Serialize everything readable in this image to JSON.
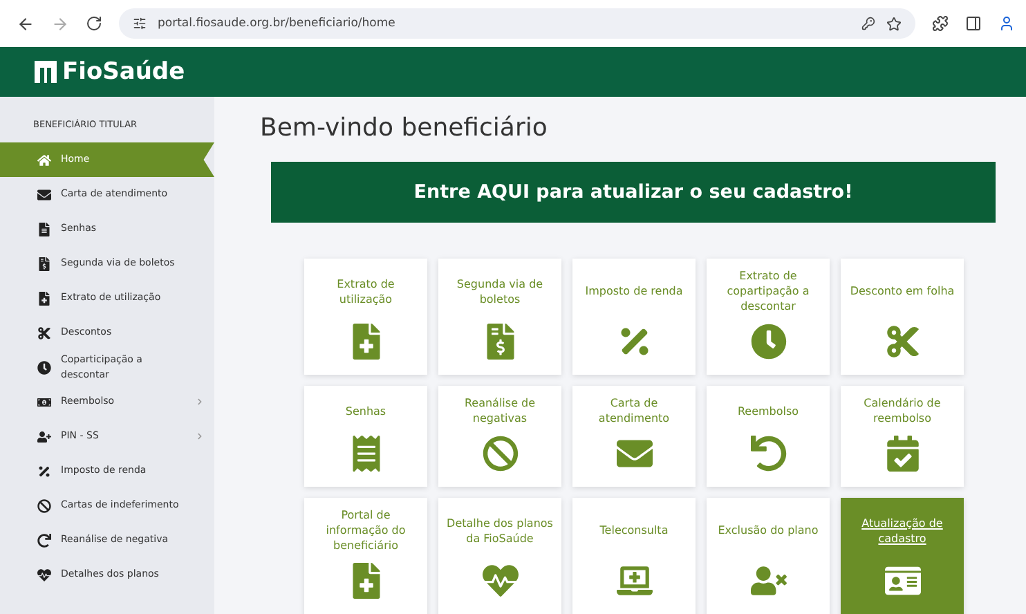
{
  "browser": {
    "url": "portal.fiosaude.org.br/beneficiario/home"
  },
  "header": {
    "logo": "FioSaúde"
  },
  "sidebar": {
    "heading": "BENEFICIÁRIO TITULAR",
    "items": [
      {
        "label": "Home",
        "selected": true,
        "submenu": false
      },
      {
        "label": "Carta de atendimento",
        "selected": false,
        "submenu": false
      },
      {
        "label": "Senhas",
        "selected": false,
        "submenu": false
      },
      {
        "label": "Segunda via de boletos",
        "selected": false,
        "submenu": false
      },
      {
        "label": "Extrato de utilização",
        "selected": false,
        "submenu": false
      },
      {
        "label": "Descontos",
        "selected": false,
        "submenu": false
      },
      {
        "label": "Coparticipação a descontar",
        "selected": false,
        "submenu": false
      },
      {
        "label": "Reembolso",
        "selected": false,
        "submenu": true
      },
      {
        "label": "PIN - SS",
        "selected": false,
        "submenu": true
      },
      {
        "label": "Imposto de renda",
        "selected": false,
        "submenu": false
      },
      {
        "label": "Cartas de indeferimento",
        "selected": false,
        "submenu": false
      },
      {
        "label": "Reanálise de negativa",
        "selected": false,
        "submenu": false
      },
      {
        "label": "Detalhes dos planos",
        "selected": false,
        "submenu": false
      }
    ]
  },
  "main": {
    "title": "Bem-vindo beneficiário",
    "banner": "Entre AQUI para atualizar o seu cadastro!",
    "tiles": [
      {
        "label": "Extrato de utilização",
        "highlighted": false
      },
      {
        "label": "Segunda via de boletos",
        "highlighted": false
      },
      {
        "label": "Imposto de renda",
        "highlighted": false
      },
      {
        "label": "Extrato de copartipação a descontar",
        "highlighted": false
      },
      {
        "label": "Desconto em folha",
        "highlighted": false
      },
      {
        "label": "Senhas",
        "highlighted": false
      },
      {
        "label": "Reanálise de negativas",
        "highlighted": false
      },
      {
        "label": "Carta de atendimento",
        "highlighted": false
      },
      {
        "label": "Reembolso",
        "highlighted": false
      },
      {
        "label": "Calendário de reembolso",
        "highlighted": false
      },
      {
        "label": "Portal de informação do beneficiário",
        "highlighted": false
      },
      {
        "label": "Detalhe dos planos da FioSaúde",
        "highlighted": false
      },
      {
        "label": "Teleconsulta",
        "highlighted": false
      },
      {
        "label": "Exclusão do plano",
        "highlighted": false
      },
      {
        "label": "Atualização de cadastro",
        "highlighted": true
      }
    ]
  }
}
